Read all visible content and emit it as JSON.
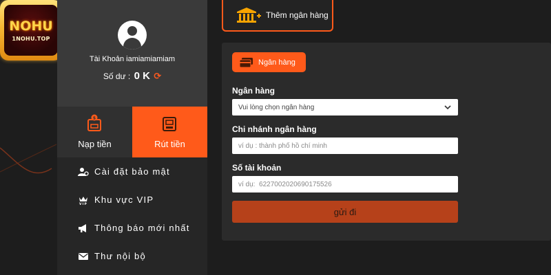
{
  "logo": {
    "main": "NOHU",
    "sub": "1NOHU.TOP"
  },
  "profile": {
    "account_label": "Tài Khoản iamiamiamiam",
    "balance_label": "Số dư :",
    "balance_value": "0 K"
  },
  "tabs": [
    {
      "label": "Nạp tiền",
      "icon": "deposit-atm-icon"
    },
    {
      "label": "Rút tiền",
      "icon": "withdraw-atm-icon"
    }
  ],
  "menu": [
    {
      "label": "Cài đặt bảo mật",
      "icon": "user-gear-icon"
    },
    {
      "label": "Khu vực VIP",
      "icon": "vip-crown-icon"
    },
    {
      "label": "Thông báo mới nhất",
      "icon": "megaphone-icon"
    },
    {
      "label": "Thư nội bộ",
      "icon": "envelope-icon"
    }
  ],
  "add_bank": {
    "label": "Thêm ngân hàng"
  },
  "form": {
    "tab_label": "Ngân hàng",
    "bank_label": "Ngân hàng",
    "bank_select_value": "Vui lòng chọn ngân hàng",
    "branch_label": "Chi nhánh ngân hàng",
    "branch_placeholder": "ví dụ : thành phố hồ chí minh",
    "account_label": "Số tài khoản",
    "account_placeholder": "ví dụ:  6227002020690175526",
    "submit_label": "gửi đi"
  },
  "colors": {
    "accent": "#ff5a1a",
    "submit": "#b6411a",
    "panel": "#2b2b2b",
    "sidebar": "#262626"
  }
}
